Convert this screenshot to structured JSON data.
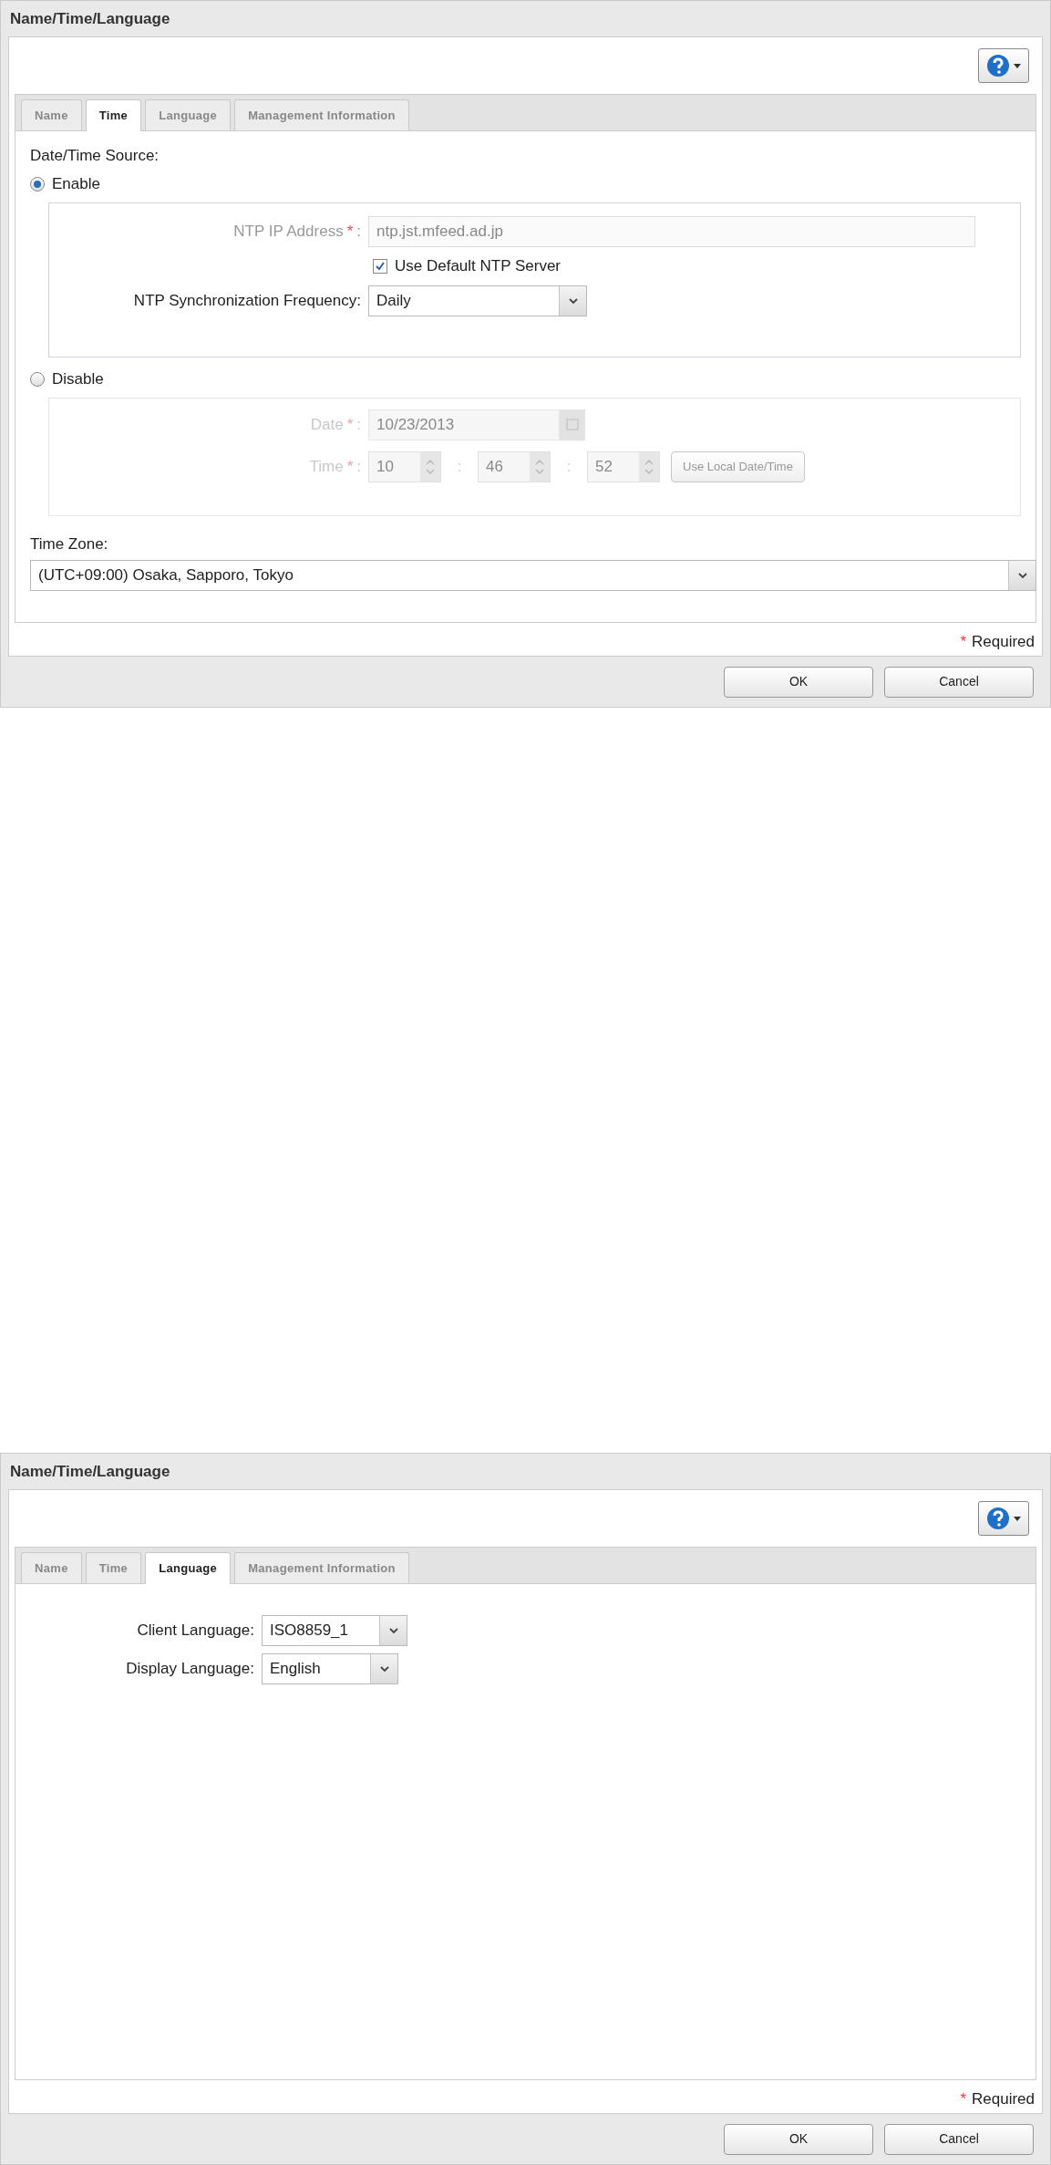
{
  "dialogs": [
    {
      "title": "Name/Time/Language",
      "tabs": [
        {
          "label": "Name",
          "selected": false
        },
        {
          "label": "Time",
          "selected": true
        },
        {
          "label": "Language",
          "selected": false
        },
        {
          "label": "Management Information",
          "selected": false
        }
      ],
      "content": {
        "kind": "time",
        "source_label": "Date/Time Source:",
        "enable": {
          "label": "Enable",
          "selected": true,
          "ntp_address": {
            "label": "NTP IP Address",
            "required_mark": "*",
            "colon": ":",
            "value": "ntp.jst.mfeed.ad.jp",
            "disabled": true
          },
          "default_server": {
            "label": "Use Default NTP Server",
            "checked": true
          },
          "frequency": {
            "label": "NTP Synchronization Frequency:",
            "value": "Daily"
          }
        },
        "disable": {
          "label": "Disable",
          "selected": false,
          "disabled": true,
          "date": {
            "label": "Date",
            "required_mark": "*",
            "colon": ":",
            "value": "10/23/2013"
          },
          "time": {
            "label": "Time",
            "required_mark": "*",
            "colon": ":",
            "hours": "10",
            "minutes": "46",
            "seconds": "52",
            "separators": [
              ":",
              ":"
            ],
            "button": "Use Local Date/Time"
          }
        },
        "time_zone": {
          "label": "Time Zone:",
          "value": "(UTC+09:00) Osaka, Sapporo, Tokyo"
        }
      },
      "required_note": {
        "mark": "*",
        "label": "Required"
      },
      "buttons": [
        "OK",
        "Cancel"
      ]
    },
    {
      "title": "Name/Time/Language",
      "tabs": [
        {
          "label": "Name",
          "selected": false
        },
        {
          "label": "Time",
          "selected": false
        },
        {
          "label": "Language",
          "selected": true
        },
        {
          "label": "Management Information",
          "selected": false
        }
      ],
      "content": {
        "kind": "language",
        "fields": [
          {
            "label": "Client Language:",
            "value": "ISO8859_1"
          },
          {
            "label": "Display Language:",
            "value": "English"
          }
        ]
      },
      "required_note": {
        "mark": "*",
        "label": "Required"
      },
      "buttons": [
        "OK",
        "Cancel"
      ]
    }
  ]
}
